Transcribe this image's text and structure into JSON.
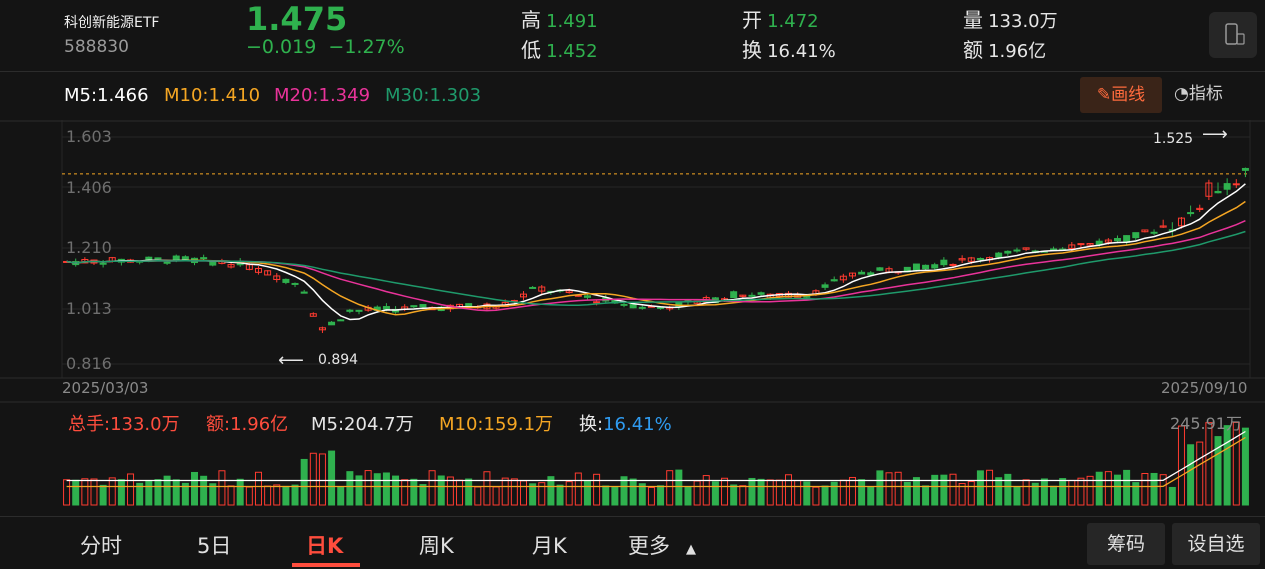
{
  "header": {
    "name": "科创新能源ETF",
    "code": "588830",
    "price": "1.475",
    "change": "−0.019",
    "change_pct": "−1.27%",
    "high_label": "高",
    "high_value": "1.491",
    "low_label": "低",
    "low_value": "1.452",
    "open_label": "开",
    "open_value": "1.472",
    "turnover_label": "换",
    "turnover_value": "16.41%",
    "volume_label": "量",
    "volume_value": "133.0万",
    "amount_label": "额",
    "amount_value": "1.96亿"
  },
  "ma": {
    "m5": "M5:1.466",
    "m10": "M10:1.410",
    "m20": "M20:1.349",
    "m30": "M30:1.303"
  },
  "toolbar": {
    "draw_label": "✎画线",
    "indicator_label": "指标"
  },
  "chart_data": {
    "type": "candlestick",
    "y_ticks": [
      "1.603",
      "1.406",
      "1.210",
      "1.013",
      "0.816"
    ],
    "ylim": [
      0.816,
      1.603
    ],
    "start_date": "2025/03/03",
    "end_date": "2025/09/10",
    "max_label": "1.525",
    "min_label": "0.894",
    "last_close": 1.475,
    "colors": {
      "up": "#ff3b30",
      "down": "#2fb14e",
      "m5": "#ffffff",
      "m10": "#f5a623",
      "m20": "#e9339a",
      "m30": "#1f9a6b"
    }
  },
  "volume": {
    "total": "总手:133.0万",
    "amount": "额:1.96亿",
    "m5": "M5:204.7万",
    "m10": "M10:159.1万",
    "turnover_label": "换:",
    "turnover_value": "16.41%",
    "max_label": "245.91万"
  },
  "tabs": [
    "分时",
    "5日",
    "日K",
    "周K",
    "月K",
    "更多"
  ],
  "active_tab": "日K",
  "right_buttons": [
    "筹码",
    "设自选"
  ]
}
